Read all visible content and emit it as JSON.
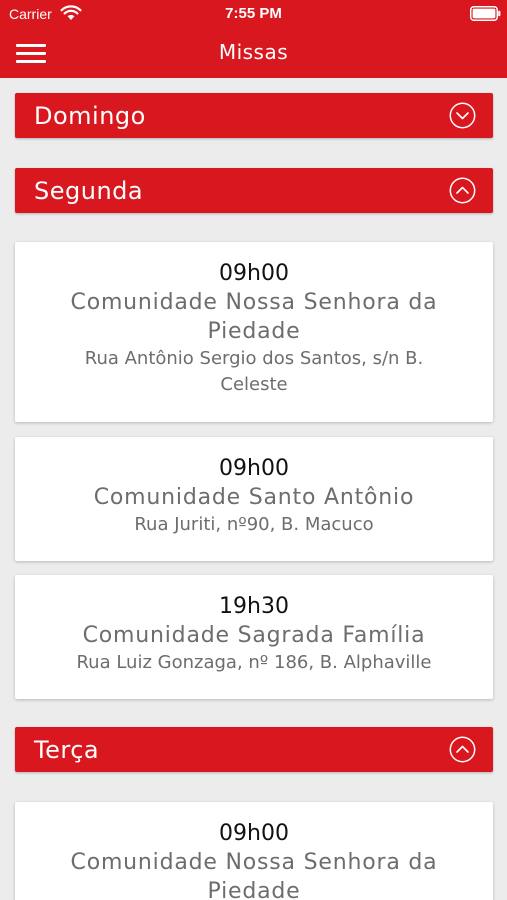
{
  "status_bar": {
    "carrier": "Carrier",
    "time": "7:55 PM",
    "wifi_icon": "wifi-icon",
    "battery_icon": "battery-icon"
  },
  "nav": {
    "title": "Missas",
    "menu_icon": "hamburger-menu-icon"
  },
  "colors": {
    "accent": "#d8171f",
    "background": "#ececec",
    "card": "#ffffff",
    "time_text": "#111111",
    "secondary_text": "#6d6d6d"
  },
  "days": [
    {
      "label": "Domingo",
      "expanded": false,
      "chevron_icon": "chevron-down-circle-icon",
      "masses": []
    },
    {
      "label": "Segunda",
      "expanded": true,
      "chevron_icon": "chevron-up-circle-icon",
      "masses": [
        {
          "time": "09h00",
          "name": "Comunidade Nossa Senhora da Piedade",
          "address": "Rua Antônio Sergio dos Santos, s/n B. Celeste"
        },
        {
          "time": "09h00",
          "name": "Comunidade Santo Antônio",
          "address": "Rua Juriti, nº90, B. Macuco"
        },
        {
          "time": "19h30",
          "name": "Comunidade Sagrada Família",
          "address": "Rua Luiz Gonzaga, nº 186, B. Alphaville"
        }
      ]
    },
    {
      "label": "Terça",
      "expanded": true,
      "chevron_icon": "chevron-up-circle-icon",
      "masses": [
        {
          "time": "09h00",
          "name": "Comunidade Nossa Senhora da Piedade"
        }
      ]
    }
  ]
}
